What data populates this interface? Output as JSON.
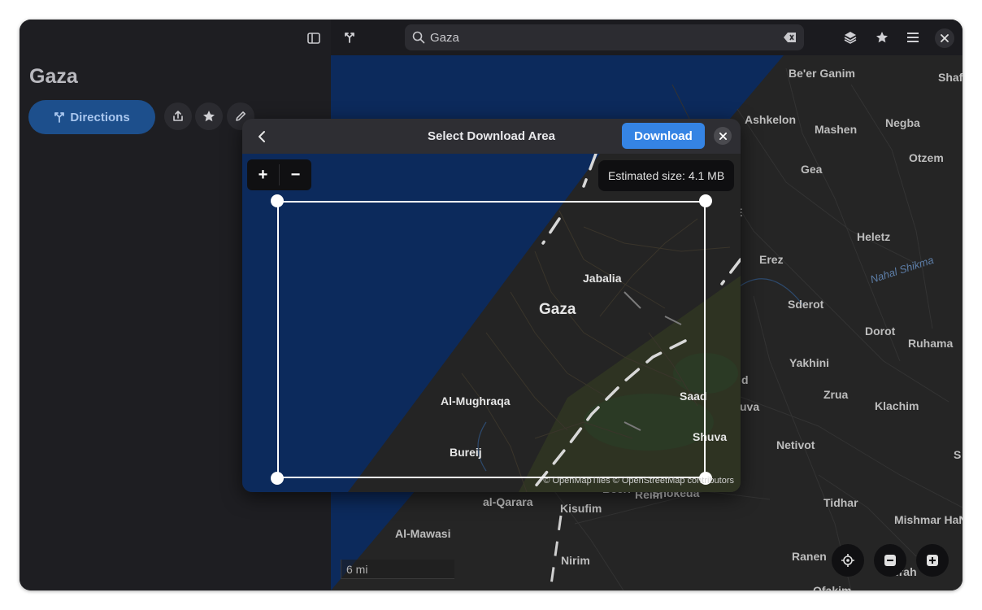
{
  "sidebar": {
    "title": "Gaza",
    "directions_label": "Directions"
  },
  "header": {
    "search": {
      "value": "Gaza",
      "placeholder": ""
    }
  },
  "dialog": {
    "title": "Select Download Area",
    "download_label": "Download",
    "zoom_in_label": "+",
    "zoom_out_label": "−",
    "estimated_size": "Estimated size: 4.1 MB",
    "attribution": "© OpenMapTiles © OpenStreetMap contributors",
    "labels": [
      {
        "text": "Jabalia"
      },
      {
        "text": "Gaza"
      },
      {
        "text": "Al-Mughraqa"
      },
      {
        "text": "Bureij"
      },
      {
        "text": "Saad"
      },
      {
        "text": "Shuva"
      }
    ]
  },
  "map": {
    "scale": "6 mi",
    "labels": [
      {
        "text": "Be'er Ganim"
      },
      {
        "text": "Shaf"
      },
      {
        "text": "Ashkelon"
      },
      {
        "text": "Mashen"
      },
      {
        "text": "Negba"
      },
      {
        "text": "Otzem"
      },
      {
        "text": "Gea"
      },
      {
        "text": "E"
      },
      {
        "text": "Heletz"
      },
      {
        "text": "Erez"
      },
      {
        "text": "Nahal Shikma"
      },
      {
        "text": "Sderot"
      },
      {
        "text": "Dorot"
      },
      {
        "text": "Ruhama"
      },
      {
        "text": "Yakhini"
      },
      {
        "text": "d"
      },
      {
        "text": "Zrua"
      },
      {
        "text": "Klachim"
      },
      {
        "text": "uva"
      },
      {
        "text": "Netivot"
      },
      {
        "text": "S"
      },
      {
        "text": "al-Qarara"
      },
      {
        "text": "Kisufim"
      },
      {
        "text": "Beeri"
      },
      {
        "text": "Reim"
      },
      {
        "text": "Shokeda"
      },
      {
        "text": "Tidhar"
      },
      {
        "text": "Mishmar HaN"
      },
      {
        "text": "Al-Mawasi"
      },
      {
        "text": "Nirim"
      },
      {
        "text": "Ranen"
      },
      {
        "text": "Tifrah"
      },
      {
        "text": "Ofakim"
      }
    ]
  },
  "colors": {
    "sea": "#0c2a5c",
    "land": "#252525",
    "accent": "#3584e4"
  }
}
